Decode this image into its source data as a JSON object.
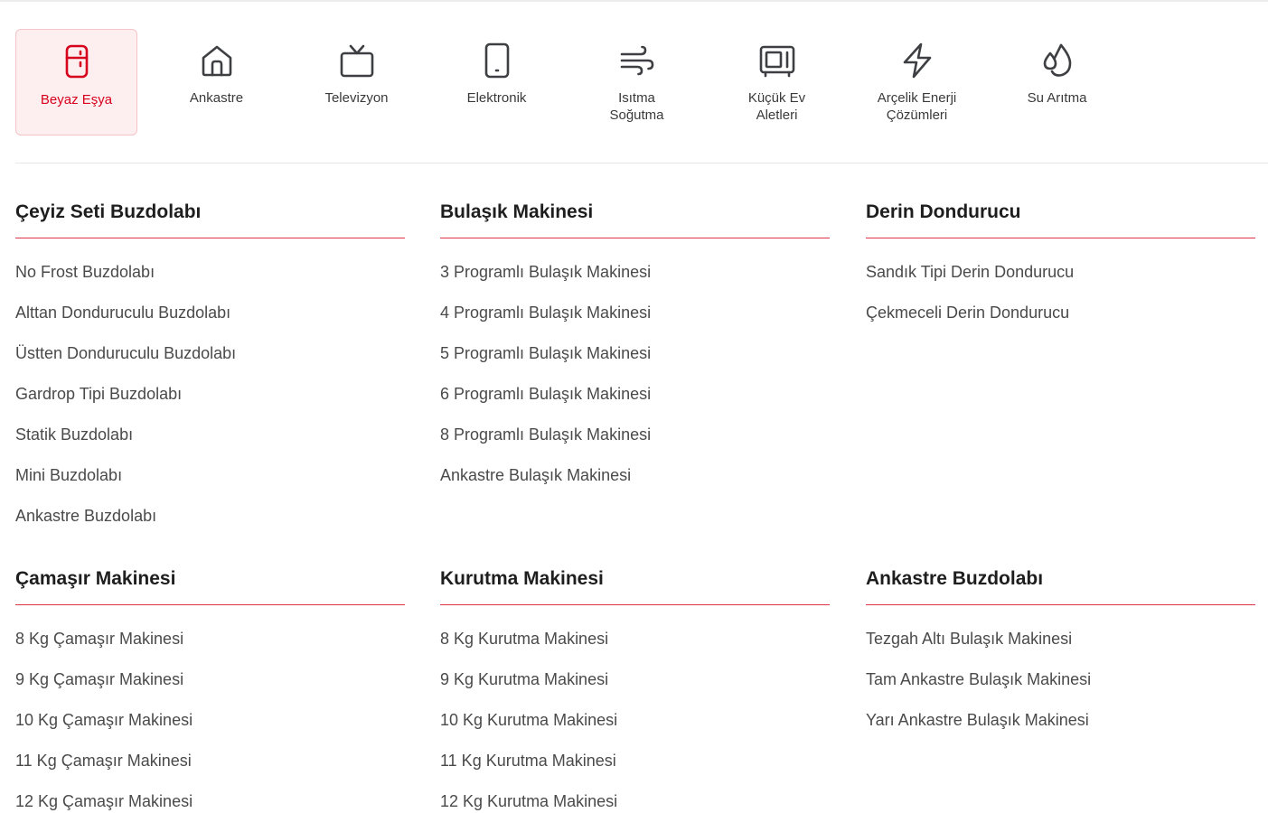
{
  "categories": [
    {
      "label": "Beyaz Eşya",
      "icon": "fridge-icon",
      "active": true
    },
    {
      "label": "Ankastre",
      "icon": "home-icon",
      "active": false
    },
    {
      "label": "Televizyon",
      "icon": "tv-icon",
      "active": false
    },
    {
      "label": "Elektronik",
      "icon": "phone-icon",
      "active": false
    },
    {
      "label": "Isıtma\nSoğutma",
      "icon": "wind-icon",
      "active": false
    },
    {
      "label": "Küçük Ev\nAletleri",
      "icon": "microwave-icon",
      "active": false
    },
    {
      "label": "Arçelik Enerji\nÇözümleri",
      "icon": "lightning-icon",
      "active": false
    },
    {
      "label": "Su Arıtma",
      "icon": "water-drops-icon",
      "active": false
    }
  ],
  "colors": {
    "accent": "#d6001c",
    "active_bg": "#fdeff0",
    "text": "#4a4a4a",
    "icon": "#3d3f42"
  },
  "groups": [
    {
      "title": "Çeyiz Seti Buzdolabı",
      "items": [
        "No Frost Buzdolabı",
        "Alttan Donduruculu Buzdolabı",
        "Üstten Donduruculu Buzdolabı",
        "Gardrop Tipi Buzdolabı",
        "Statik Buzdolabı",
        "Mini Buzdolabı",
        "Ankastre Buzdolabı"
      ]
    },
    {
      "title": "Bulaşık Makinesi",
      "items": [
        "3 Programlı Bulaşık Makinesi",
        "4 Programlı Bulaşık Makinesi",
        "5 Programlı Bulaşık Makinesi",
        "6 Programlı Bulaşık Makinesi",
        "8 Programlı Bulaşık Makinesi",
        "Ankastre Bulaşık Makinesi"
      ]
    },
    {
      "title": "Derin Dondurucu",
      "items": [
        "Sandık Tipi Derin Dondurucu",
        "Çekmeceli Derin Dondurucu"
      ]
    },
    {
      "title": "Çamaşır Makinesi",
      "items": [
        "8 Kg Çamaşır Makinesi",
        "9 Kg Çamaşır Makinesi",
        "10 Kg Çamaşır Makinesi",
        "11 Kg Çamaşır Makinesi",
        "12 Kg Çamaşır Makinesi"
      ]
    },
    {
      "title": "Kurutma Makinesi",
      "items": [
        "8 Kg Kurutma Makinesi",
        "9 Kg Kurutma Makinesi",
        "10 Kg Kurutma Makinesi",
        "11 Kg Kurutma Makinesi",
        "12 Kg Kurutma Makinesi"
      ]
    },
    {
      "title": "Ankastre Buzdolabı",
      "items": [
        "Tezgah Altı Bulaşık Makinesi",
        "Tam Ankastre Bulaşık Makinesi",
        "Yarı Ankastre Bulaşık Makinesi"
      ]
    }
  ]
}
